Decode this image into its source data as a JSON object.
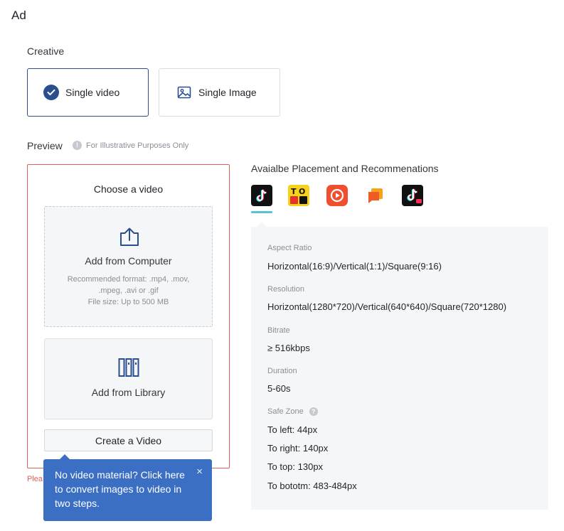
{
  "page": {
    "title": "Ad"
  },
  "creative": {
    "label": "Creative",
    "options": [
      {
        "label": "Single video",
        "selected": true
      },
      {
        "label": "Single Image",
        "selected": false
      }
    ]
  },
  "preview": {
    "label": "Preview",
    "note": "For Illustrative Purposes Only"
  },
  "chooser": {
    "title": "Choose a video",
    "computer": {
      "label": "Add from Computer",
      "format_line1": "Recommended format: .mp4, .mov,",
      "format_line2": ".mpeg, .avi or .gif",
      "size": "File size: Up to 500 MB"
    },
    "library": {
      "label": "Add from Library"
    },
    "create_button": "Create a Video",
    "error_partial": "Plea",
    "tooltip": {
      "text": "No video material? Click here to convert images to video in two steps.",
      "close": "×"
    }
  },
  "placement": {
    "title": "Avaialbe Placement and Recommenations",
    "platforms": [
      {
        "name": "TikTok",
        "icon": "tiktok-icon",
        "selected": true
      },
      {
        "name": "TopBuzz",
        "icon": "topbuzz-icon",
        "selected": false
      },
      {
        "name": "Vigo Video",
        "icon": "vigo-icon",
        "selected": false
      },
      {
        "name": "BaBe",
        "icon": "babe-icon",
        "selected": false
      },
      {
        "name": "TikTok Lite",
        "icon": "tiktok-lite-icon",
        "selected": false
      }
    ]
  },
  "specs": {
    "aspect_ratio_label": "Aspect Ratio",
    "aspect_ratio_value": "Horizontal(16:9)/Vertical(1:1)/Square(9:16)",
    "resolution_label": "Resolution",
    "resolution_value": "Horizontal(1280*720)/Vertical(640*640)/Square(720*1280)",
    "bitrate_label": "Bitrate",
    "bitrate_value": "≥ 516kbps",
    "duration_label": "Duration",
    "duration_value": "5-60s",
    "safe_zone_label": "Safe Zone",
    "safe_left": "To left: 44px",
    "safe_right": "To right: 140px",
    "safe_top": "To top: 130px",
    "safe_bottom": "To bototm: 483-484px"
  },
  "colors": {
    "accent": "#2b4f8e",
    "tooltip": "#3b6fc4",
    "error": "#e0614f",
    "tab_underline": "#5bbfd6"
  }
}
